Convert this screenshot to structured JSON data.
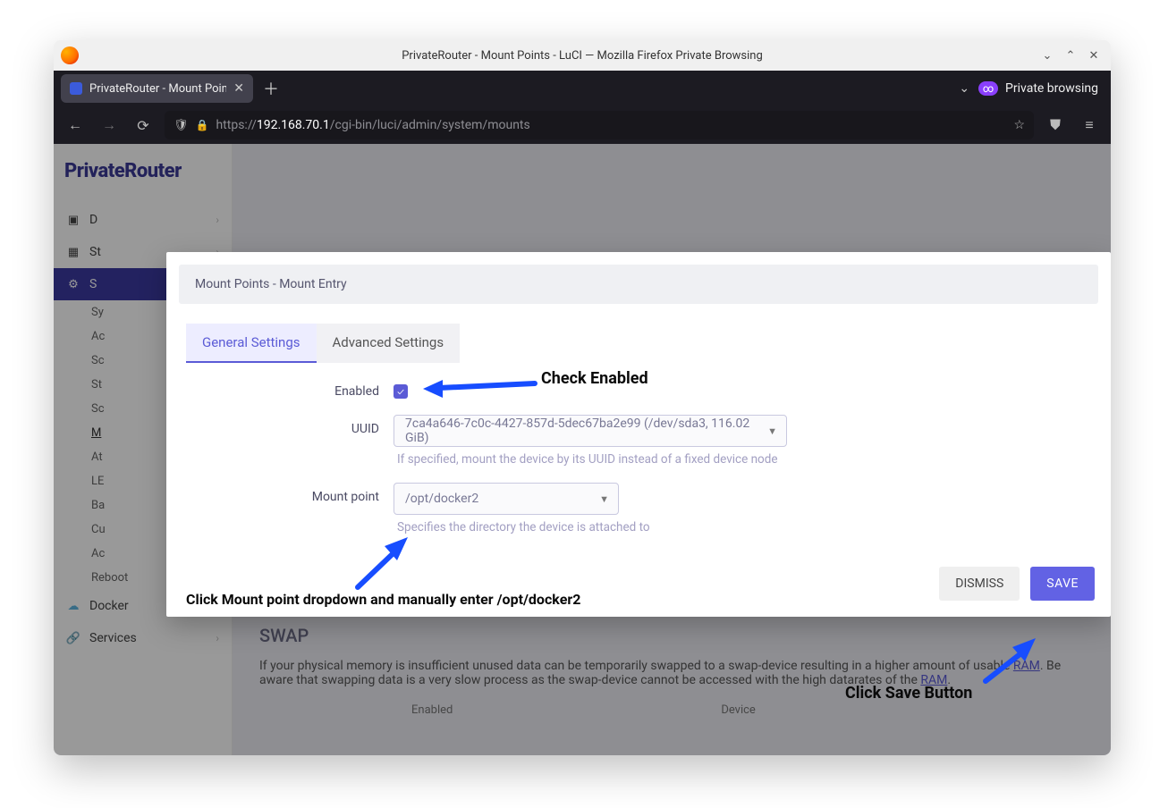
{
  "window": {
    "title": "PrivateRouter - Mount Points - LuCI — Mozilla Firefox Private Browsing"
  },
  "tab": {
    "title": "PrivateRouter - Mount Poin"
  },
  "private_label": "Private browsing",
  "url": {
    "scheme": "https://",
    "host": "192.168.70.1",
    "path": "/cgi-bin/luci/admin/system/mounts"
  },
  "brand": "PrivateRouter",
  "sidebar": {
    "items": [
      {
        "letter": "D"
      },
      {
        "letter": "St"
      },
      {
        "letter": "S"
      }
    ],
    "subs": [
      "Sy",
      "Ac",
      "Sc",
      "St",
      "Sc",
      "M",
      "At",
      "LE",
      "Ba",
      "Cu",
      "Ac",
      "Reboot"
    ],
    "docker": "Docker",
    "services": "Services"
  },
  "modal": {
    "title": "Mount Points - Mount Entry",
    "tabs": {
      "general": "General Settings",
      "advanced": "Advanced Settings"
    },
    "enabled_label": "Enabled",
    "uuid_label": "UUID",
    "uuid_value": "7ca4a646-7c0c-4427-857d-5dec67ba2e99 (/dev/sda3, 116.02 GiB)",
    "uuid_hint": "If specified, mount the device by its UUID instead of a fixed device node",
    "mount_label": "Mount point",
    "mount_value": "/opt/docker2",
    "mount_hint": "Specifies the directory the device is attached to",
    "dismiss": "DISMISS",
    "save": "SAVE"
  },
  "swap": {
    "heading": "SWAP",
    "text1": "If your physical memory is insufficient unused data can be temporarily swapped to a swap-device resulting in a higher amount of usable ",
    "link1": "RAM",
    "text2": ". Be aware that swapping data is a very slow process as the swap-device cannot be accessed with the high datarates of the ",
    "link2": "RAM",
    "text3": ".",
    "col1": "Enabled",
    "col2": "Device"
  },
  "annots": {
    "check_enabled": "Check Enabled",
    "mount_instr": "Click Mount point dropdown and manually enter /opt/docker2",
    "save_instr": "Click Save Button"
  }
}
